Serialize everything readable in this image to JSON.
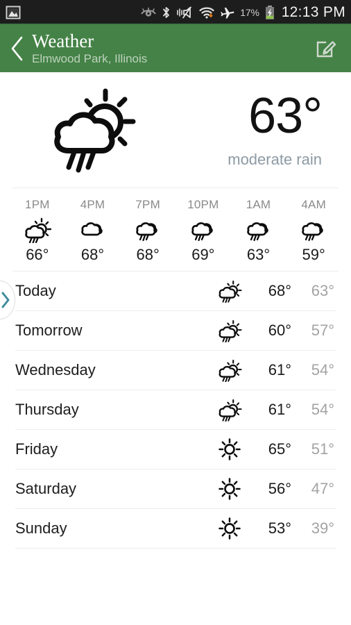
{
  "status_bar": {
    "icons_left": [
      "gallery-image-icon"
    ],
    "icons_right": [
      "smart-stay-eye-icon",
      "bluetooth-icon",
      "vibrate-mute-icon",
      "wifi-icon",
      "airplane-mode-icon"
    ],
    "battery_percent": "17%",
    "battery_state": "charging",
    "clock": "12:13 PM",
    "background": "#1d1d1d"
  },
  "app_bar": {
    "back_icon": "back-chevron-icon",
    "title": "Weather",
    "subtitle": "Elmwood Park, Illinois",
    "edit_icon": "edit-compose-icon",
    "background": "#458247"
  },
  "current": {
    "icon": "sun-behind-rain-cloud-icon",
    "temperature": "63°",
    "description": "moderate rain"
  },
  "hourly": [
    {
      "time": "1PM",
      "icon": "sun-behind-rain-cloud-icon",
      "temp": "66°"
    },
    {
      "time": "4PM",
      "icon": "cloudy-icon",
      "temp": "68°"
    },
    {
      "time": "7PM",
      "icon": "rain-cloud-icon",
      "temp": "68°"
    },
    {
      "time": "10PM",
      "icon": "rain-cloud-icon",
      "temp": "69°"
    },
    {
      "time": "1AM",
      "icon": "rain-cloud-icon",
      "temp": "63°"
    },
    {
      "time": "4AM",
      "icon": "rain-cloud-icon",
      "temp": "59°"
    }
  ],
  "daily": [
    {
      "day": "Today",
      "icon": "sun-behind-rain-cloud-icon",
      "high": "68°",
      "low": "63°"
    },
    {
      "day": "Tomorrow",
      "icon": "sun-behind-rain-cloud-icon",
      "high": "60°",
      "low": "57°"
    },
    {
      "day": "Wednesday",
      "icon": "sun-behind-rain-cloud-icon",
      "high": "61°",
      "low": "54°"
    },
    {
      "day": "Thursday",
      "icon": "sun-behind-rain-cloud-icon",
      "high": "61°",
      "low": "54°"
    },
    {
      "day": "Friday",
      "icon": "sun-icon",
      "high": "65°",
      "low": "51°"
    },
    {
      "day": "Saturday",
      "icon": "sun-icon",
      "high": "56°",
      "low": "47°"
    },
    {
      "day": "Sunday",
      "icon": "sun-icon",
      "high": "53°",
      "low": "39°"
    }
  ],
  "edge_tab": {
    "icon": "chevron-right-icon",
    "color": "#3f8a9e"
  }
}
